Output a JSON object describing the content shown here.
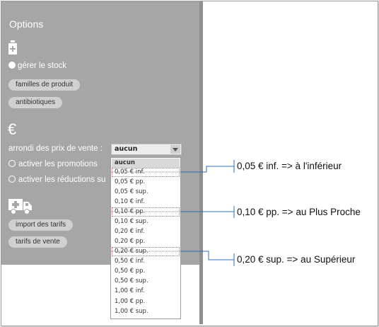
{
  "panel": {
    "title": "Options",
    "stock_label": "gérer le stock",
    "pill_family": "familles de produit",
    "pill_antibio": "antibiotiques",
    "euro_symbol": "€",
    "arrondi_label": "arrondi des prix de vente :",
    "select_value": "aucun",
    "promo_label": "activer les promotions",
    "reductions_label": "activer les réductions su",
    "pill_import": "import des tarifs",
    "pill_tarifs": "tarifs de vente"
  },
  "dropdown": {
    "items": [
      "aucun",
      "0,05 € inf.",
      "0,05 € pp.",
      "0,05 € sup.",
      "0,10 € inf.",
      "0,10 € pp.",
      "0,10 € sup.",
      "0,20 € inf.",
      "0,20 € pp.",
      "0,20 € sup.",
      "0,50 € inf.",
      "0,50 € pp.",
      "0,50 € sup.",
      "1,00 € inf.",
      "1,00 € pp.",
      "1,00 € sup."
    ]
  },
  "annotations": {
    "a1": "0,05 € inf. => à l'inférieur",
    "a2": "0,10 € pp. => au Plus Proche",
    "a3": "0,20 € sup. => au Supérieur"
  },
  "colors": {
    "panel_bg": "#a6a6a6",
    "callout_line": "#2f6fb5",
    "marker": "#d06080"
  },
  "icons": [
    "stock-bottle-icon",
    "euro-icon",
    "delivery-truck-icon",
    "chevron-down-icon"
  ]
}
